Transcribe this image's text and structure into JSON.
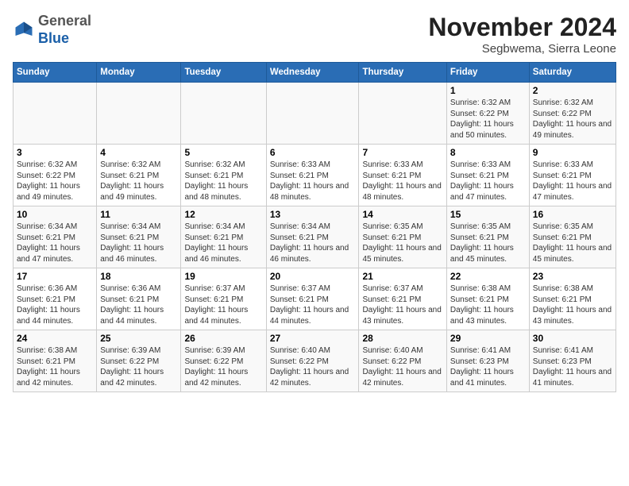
{
  "header": {
    "logo_general": "General",
    "logo_blue": "Blue",
    "month": "November 2024",
    "location": "Segbwema, Sierra Leone"
  },
  "weekdays": [
    "Sunday",
    "Monday",
    "Tuesday",
    "Wednesday",
    "Thursday",
    "Friday",
    "Saturday"
  ],
  "weeks": [
    [
      {
        "day": "",
        "info": ""
      },
      {
        "day": "",
        "info": ""
      },
      {
        "day": "",
        "info": ""
      },
      {
        "day": "",
        "info": ""
      },
      {
        "day": "",
        "info": ""
      },
      {
        "day": "1",
        "info": "Sunrise: 6:32 AM\nSunset: 6:22 PM\nDaylight: 11 hours and 50 minutes."
      },
      {
        "day": "2",
        "info": "Sunrise: 6:32 AM\nSunset: 6:22 PM\nDaylight: 11 hours and 49 minutes."
      }
    ],
    [
      {
        "day": "3",
        "info": "Sunrise: 6:32 AM\nSunset: 6:22 PM\nDaylight: 11 hours and 49 minutes."
      },
      {
        "day": "4",
        "info": "Sunrise: 6:32 AM\nSunset: 6:21 PM\nDaylight: 11 hours and 49 minutes."
      },
      {
        "day": "5",
        "info": "Sunrise: 6:32 AM\nSunset: 6:21 PM\nDaylight: 11 hours and 48 minutes."
      },
      {
        "day": "6",
        "info": "Sunrise: 6:33 AM\nSunset: 6:21 PM\nDaylight: 11 hours and 48 minutes."
      },
      {
        "day": "7",
        "info": "Sunrise: 6:33 AM\nSunset: 6:21 PM\nDaylight: 11 hours and 48 minutes."
      },
      {
        "day": "8",
        "info": "Sunrise: 6:33 AM\nSunset: 6:21 PM\nDaylight: 11 hours and 47 minutes."
      },
      {
        "day": "9",
        "info": "Sunrise: 6:33 AM\nSunset: 6:21 PM\nDaylight: 11 hours and 47 minutes."
      }
    ],
    [
      {
        "day": "10",
        "info": "Sunrise: 6:34 AM\nSunset: 6:21 PM\nDaylight: 11 hours and 47 minutes."
      },
      {
        "day": "11",
        "info": "Sunrise: 6:34 AM\nSunset: 6:21 PM\nDaylight: 11 hours and 46 minutes."
      },
      {
        "day": "12",
        "info": "Sunrise: 6:34 AM\nSunset: 6:21 PM\nDaylight: 11 hours and 46 minutes."
      },
      {
        "day": "13",
        "info": "Sunrise: 6:34 AM\nSunset: 6:21 PM\nDaylight: 11 hours and 46 minutes."
      },
      {
        "day": "14",
        "info": "Sunrise: 6:35 AM\nSunset: 6:21 PM\nDaylight: 11 hours and 45 minutes."
      },
      {
        "day": "15",
        "info": "Sunrise: 6:35 AM\nSunset: 6:21 PM\nDaylight: 11 hours and 45 minutes."
      },
      {
        "day": "16",
        "info": "Sunrise: 6:35 AM\nSunset: 6:21 PM\nDaylight: 11 hours and 45 minutes."
      }
    ],
    [
      {
        "day": "17",
        "info": "Sunrise: 6:36 AM\nSunset: 6:21 PM\nDaylight: 11 hours and 44 minutes."
      },
      {
        "day": "18",
        "info": "Sunrise: 6:36 AM\nSunset: 6:21 PM\nDaylight: 11 hours and 44 minutes."
      },
      {
        "day": "19",
        "info": "Sunrise: 6:37 AM\nSunset: 6:21 PM\nDaylight: 11 hours and 44 minutes."
      },
      {
        "day": "20",
        "info": "Sunrise: 6:37 AM\nSunset: 6:21 PM\nDaylight: 11 hours and 44 minutes."
      },
      {
        "day": "21",
        "info": "Sunrise: 6:37 AM\nSunset: 6:21 PM\nDaylight: 11 hours and 43 minutes."
      },
      {
        "day": "22",
        "info": "Sunrise: 6:38 AM\nSunset: 6:21 PM\nDaylight: 11 hours and 43 minutes."
      },
      {
        "day": "23",
        "info": "Sunrise: 6:38 AM\nSunset: 6:21 PM\nDaylight: 11 hours and 43 minutes."
      }
    ],
    [
      {
        "day": "24",
        "info": "Sunrise: 6:38 AM\nSunset: 6:21 PM\nDaylight: 11 hours and 42 minutes."
      },
      {
        "day": "25",
        "info": "Sunrise: 6:39 AM\nSunset: 6:22 PM\nDaylight: 11 hours and 42 minutes."
      },
      {
        "day": "26",
        "info": "Sunrise: 6:39 AM\nSunset: 6:22 PM\nDaylight: 11 hours and 42 minutes."
      },
      {
        "day": "27",
        "info": "Sunrise: 6:40 AM\nSunset: 6:22 PM\nDaylight: 11 hours and 42 minutes."
      },
      {
        "day": "28",
        "info": "Sunrise: 6:40 AM\nSunset: 6:22 PM\nDaylight: 11 hours and 42 minutes."
      },
      {
        "day": "29",
        "info": "Sunrise: 6:41 AM\nSunset: 6:23 PM\nDaylight: 11 hours and 41 minutes."
      },
      {
        "day": "30",
        "info": "Sunrise: 6:41 AM\nSunset: 6:23 PM\nDaylight: 11 hours and 41 minutes."
      }
    ]
  ]
}
